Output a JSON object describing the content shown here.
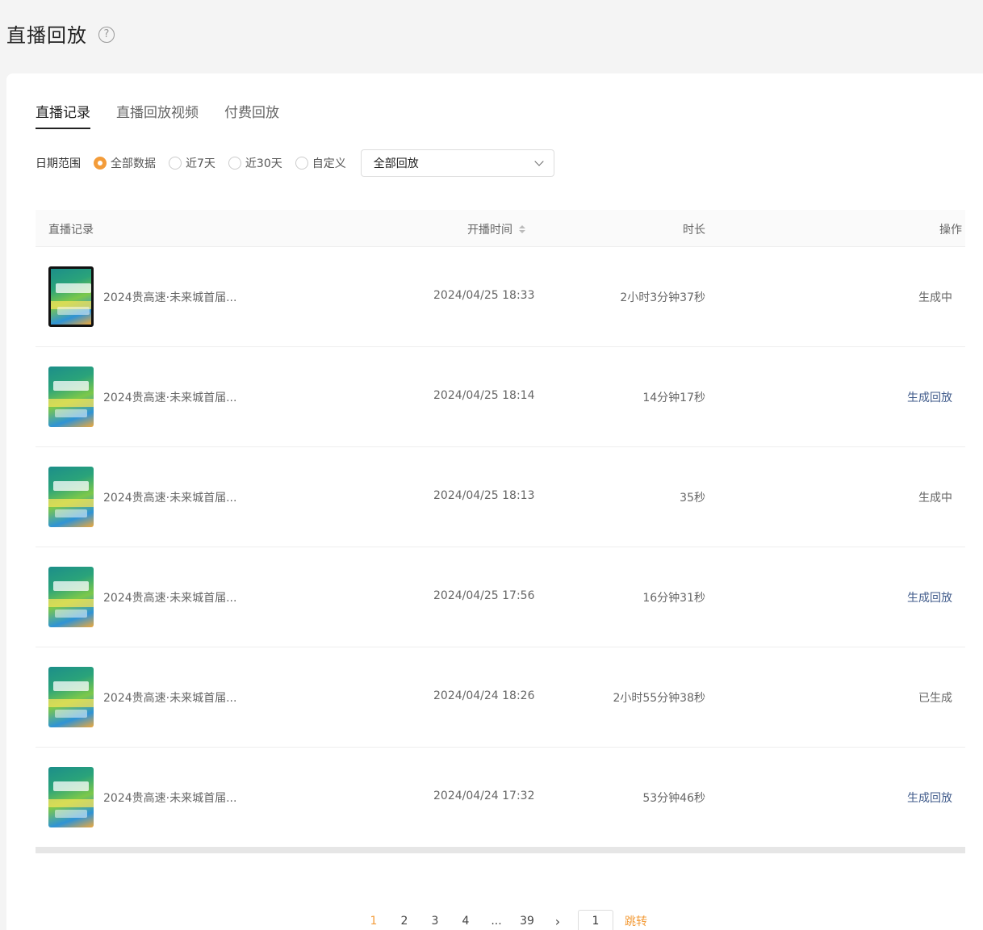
{
  "header": {
    "title": "直播回放",
    "help_icon": "question-circle-icon"
  },
  "tabs": [
    {
      "label": "直播记录",
      "active": true
    },
    {
      "label": "直播回放视频",
      "active": false
    },
    {
      "label": "付费回放",
      "active": false
    }
  ],
  "filter": {
    "label": "日期范围",
    "options": [
      {
        "label": "全部数据",
        "checked": true
      },
      {
        "label": "近7天",
        "checked": false
      },
      {
        "label": "近30天",
        "checked": false
      },
      {
        "label": "自定义",
        "checked": false
      }
    ],
    "select_value": "全部回放"
  },
  "table": {
    "columns": {
      "record": "直播记录",
      "time": "开播时间",
      "duration": "时长",
      "action": "操作"
    },
    "rows": [
      {
        "title": "2024贵高速·未来城首届...",
        "time": "2024/04/25 18:33",
        "duration": "2小时3分钟37秒",
        "action": "生成中"
      },
      {
        "title": "2024贵高速·未来城首届...",
        "time": "2024/04/25 18:14",
        "duration": "14分钟17秒",
        "action": "生成回放"
      },
      {
        "title": "2024贵高速·未来城首届...",
        "time": "2024/04/25 18:13",
        "duration": "35秒",
        "action": "生成中"
      },
      {
        "title": "2024贵高速·未来城首届...",
        "time": "2024/04/25 17:56",
        "duration": "16分钟31秒",
        "action": "生成回放"
      },
      {
        "title": "2024贵高速·未来城首届...",
        "time": "2024/04/24 18:26",
        "duration": "2小时55分钟38秒",
        "action": "已生成"
      },
      {
        "title": "2024贵高速·未来城首届...",
        "time": "2024/04/24 17:32",
        "duration": "53分钟46秒",
        "action": "生成回放"
      }
    ]
  },
  "pagination": {
    "pages": [
      "1",
      "2",
      "3",
      "4",
      "...",
      "39"
    ],
    "current": "1",
    "next": "›",
    "jump_value": "1",
    "jump_label": "跳转"
  },
  "colors": {
    "accent": "#f39c3a",
    "link": "#3f5a8a"
  }
}
